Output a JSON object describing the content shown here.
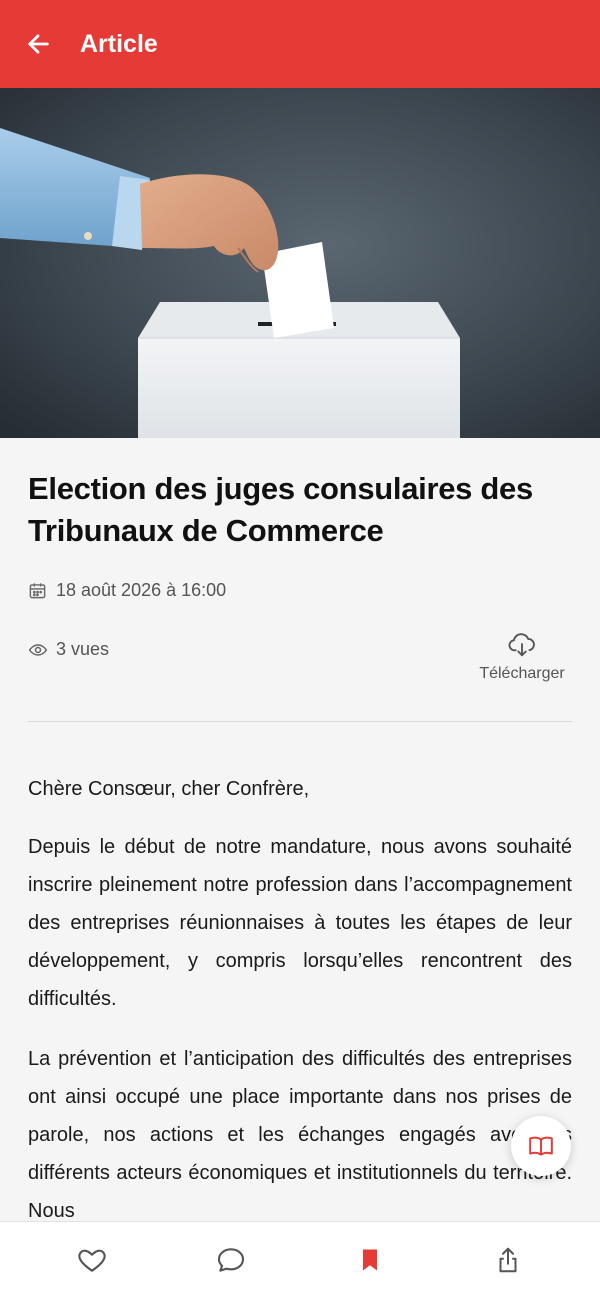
{
  "header": {
    "title": "Article"
  },
  "hero": {
    "alt": "Main glissant un bulletin dans une urne"
  },
  "article": {
    "title": "Election des juges consulaires des Tribunaux de Commerce",
    "date": "18 août 2026 à 16:00",
    "views": "3 vues",
    "download_label": "Télécharger",
    "paragraphs": [
      "Chère Consœur, cher Confrère,",
      "Depuis le début de notre mandature, nous avons souhaité inscrire pleinement notre profession dans l’accompagnement des entreprises réunionnaises à toutes les étapes de leur développement, y compris lorsqu’elles rencontrent des difficultés.",
      "La prévention et l’anticipation des difficultés des entreprises ont ainsi occupé une place importante dans nos prises de parole, nos actions et les échanges engagés avec les différents acteurs économiques et institutionnels du territoire. Nous"
    ]
  },
  "colors": {
    "brand": "#e63a37",
    "background": "#f5f5f5"
  },
  "icons": {
    "back": "arrow-left-icon",
    "calendar": "calendar-icon",
    "views": "eye-icon",
    "download": "cloud-download-icon",
    "reader": "book-open-icon",
    "like": "heart-icon",
    "comment": "comment-icon",
    "bookmark": "bookmark-icon",
    "share": "share-icon"
  }
}
